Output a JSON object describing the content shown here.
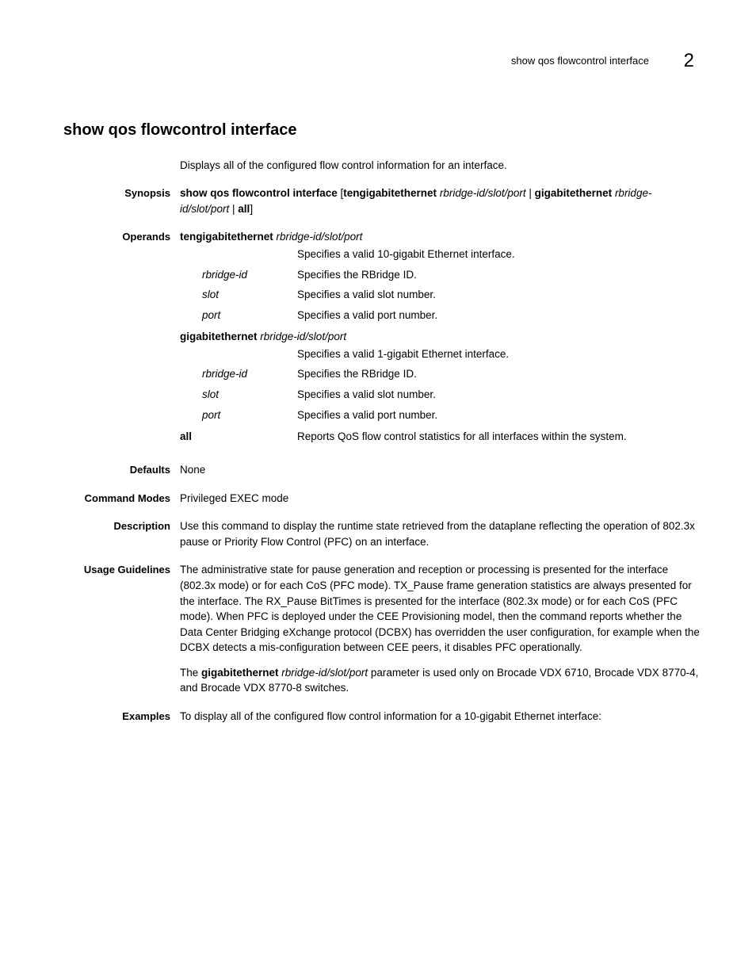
{
  "header": {
    "running": "show qos flowcontrol interface",
    "chapter": "2"
  },
  "title": "show qos flowcontrol interface",
  "intro": "Displays all of the configured flow control information for an interface.",
  "labels": {
    "synopsis": "Synopsis",
    "operands": "Operands",
    "defaults": "Defaults",
    "command_modes": "Command Modes",
    "description": "Description",
    "usage": "Usage Guidelines",
    "examples": "Examples"
  },
  "synopsis": {
    "cmd": "show qos flowcontrol interface",
    "b1": " [",
    "teng": "tengigabitethernet",
    "sp1": " ",
    "arg1": "rbridge-id/slot/port",
    "pipe1": " | ",
    "gig": "gigabitethernet",
    "sp2": " ",
    "arg2": "rbridge-id/slot/port",
    "pipe2": " | ",
    "all": "all",
    "b2": "]"
  },
  "operands": {
    "teng": {
      "kw": "tengigabitethernet",
      "arg": "rbridge-id/slot/port",
      "desc": "Specifies a valid 10-gigabit Ethernet interface.",
      "subs": [
        {
          "term": "rbridge-id",
          "desc": "Specifies the RBridge ID."
        },
        {
          "term": "slot",
          "desc": "Specifies a valid slot number."
        },
        {
          "term": "port",
          "desc": "Specifies a valid port number."
        }
      ]
    },
    "gig": {
      "kw": "gigabitethernet",
      "arg": "rbridge-id/slot/port",
      "desc": "Specifies a valid 1-gigabit Ethernet interface.",
      "subs": [
        {
          "term": "rbridge-id",
          "desc": "Specifies the RBridge ID."
        },
        {
          "term": "slot",
          "desc": "Specifies a valid slot number."
        },
        {
          "term": "port",
          "desc": "Specifies a valid port number."
        }
      ]
    },
    "all": {
      "kw": "all",
      "desc": "Reports QoS flow control statistics for all interfaces within the system."
    }
  },
  "defaults": "None",
  "command_modes": "Privileged EXEC mode",
  "description": "Use this command to display the runtime state retrieved from the dataplane reflecting the operation of 802.3x pause or Priority Flow Control (PFC) on an interface.",
  "usage": {
    "p1": "The administrative state for pause generation and reception or processing is presented for the interface (802.3x mode) or for each CoS (PFC mode). TX_Pause frame generation statistics are always presented for the interface. The RX_Pause BitTimes is presented for the interface (802.3x mode) or for each CoS (PFC mode). When PFC is deployed under the CEE Provisioning model, then the command reports whether the Data Center Bridging eXchange protocol (DCBX) has overridden the user configuration, for example when the DCBX detects a mis-configuration between CEE peers, it disables PFC operationally.",
    "p2a": "The ",
    "p2b": "gigabitethernet",
    "p2c": " ",
    "p2d": "rbridge-id/slot/port",
    "p2e": " parameter is used only on Brocade VDX 6710, Brocade VDX 8770-4, and Brocade VDX 8770-8 switches."
  },
  "examples": "To display all of the configured flow control information for a 10-gigabit Ethernet interface:"
}
